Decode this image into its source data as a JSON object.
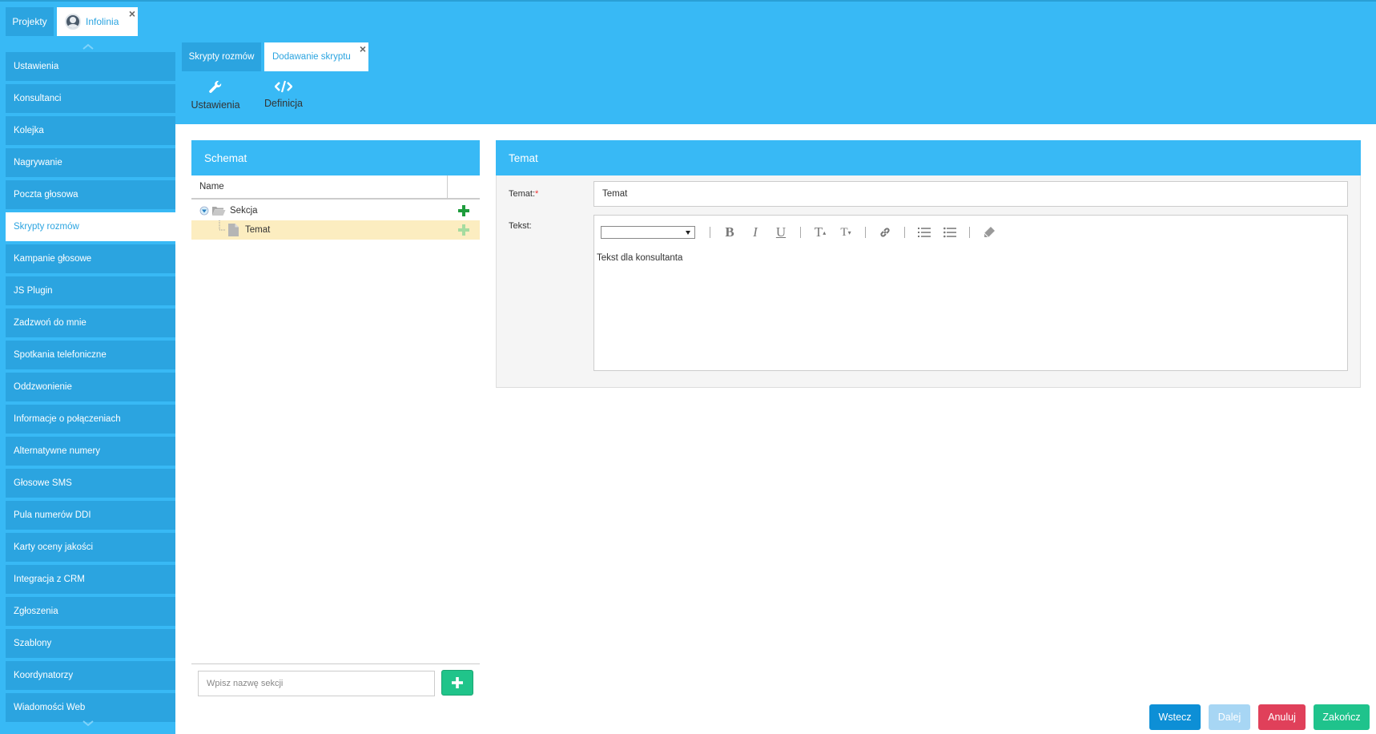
{
  "top_tabs": {
    "projekty": "Projekty",
    "infolinia": "Infolinia"
  },
  "sidebar": {
    "items": [
      {
        "label": "Ustawienia"
      },
      {
        "label": "Konsultanci"
      },
      {
        "label": "Kolejka"
      },
      {
        "label": "Nagrywanie"
      },
      {
        "label": "Poczta głosowa"
      },
      {
        "label": "Skrypty rozmów",
        "active": true
      },
      {
        "label": "Kampanie głosowe"
      },
      {
        "label": "JS Plugin"
      },
      {
        "label": "Zadzwoń do mnie"
      },
      {
        "label": "Spotkania telefoniczne"
      },
      {
        "label": "Oddzwonienie"
      },
      {
        "label": "Informacje o połączeniach"
      },
      {
        "label": "Alternatywne numery"
      },
      {
        "label": "Głosowe SMS"
      },
      {
        "label": "Pula numerów DDI"
      },
      {
        "label": "Karty oceny jakości"
      },
      {
        "label": "Integracja z CRM"
      },
      {
        "label": "Zgłoszenia"
      },
      {
        "label": "Szablony"
      },
      {
        "label": "Koordynatorzy"
      },
      {
        "label": "Wiadomości Web"
      }
    ]
  },
  "sub_tabs": {
    "t1": "Skrypty rozmów",
    "t2": "Dodawanie skryptu"
  },
  "toolbar": {
    "settings_label": "Ustawienia",
    "definition_label": "Definicja"
  },
  "schemat": {
    "title": "Schemat",
    "column_name": "Name",
    "tree": {
      "section": "Sekcja",
      "topic": "Temat"
    },
    "section_placeholder": "Wpisz nazwę sekcji"
  },
  "temat": {
    "title": "Temat",
    "label_temat": "Temat:",
    "required_mark": "*",
    "temat_value": "Temat",
    "label_tekst": "Tekst:",
    "editor_text": "Tekst dla konsultanta"
  },
  "footer": {
    "back": "Wstecz",
    "next": "Dalej",
    "cancel": "Anuluj",
    "finish": "Zakończ"
  },
  "colors": {
    "primary": "#38b9f5",
    "secondary": "#2ba4e0",
    "success": "#1fc38c",
    "danger": "#e0405a",
    "selected_row": "#fcedc0"
  }
}
